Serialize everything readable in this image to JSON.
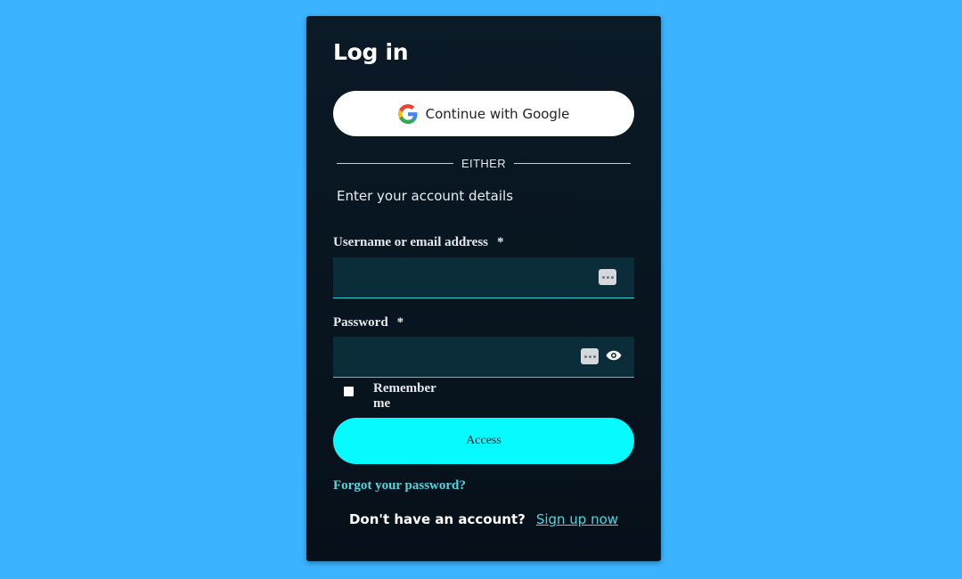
{
  "login": {
    "title": "Log in",
    "google_button_label": "Continue with Google",
    "divider_text": "EITHER",
    "subtitle": "Enter your account details",
    "username_label": "Username or email address",
    "password_label": "Password",
    "required_marker": "*",
    "remember_label": "Remember me",
    "access_button_label": "Access",
    "forgot_link": "Forgot your password?",
    "no_account_text": "Don't have an account?",
    "signup_link": "Sign up now"
  },
  "fields": {
    "username_value": "",
    "password_value": ""
  },
  "colors": {
    "page_background": "#3bb3ff",
    "card_background": "#0a1a26",
    "input_background": "#0b2d3a",
    "accent_cyan": "#05fbff",
    "link_color": "#4fd6e0"
  },
  "icons": {
    "google": "google-g-icon",
    "autofill_key": "password-manager-key-icon",
    "show_password": "eye-icon"
  }
}
